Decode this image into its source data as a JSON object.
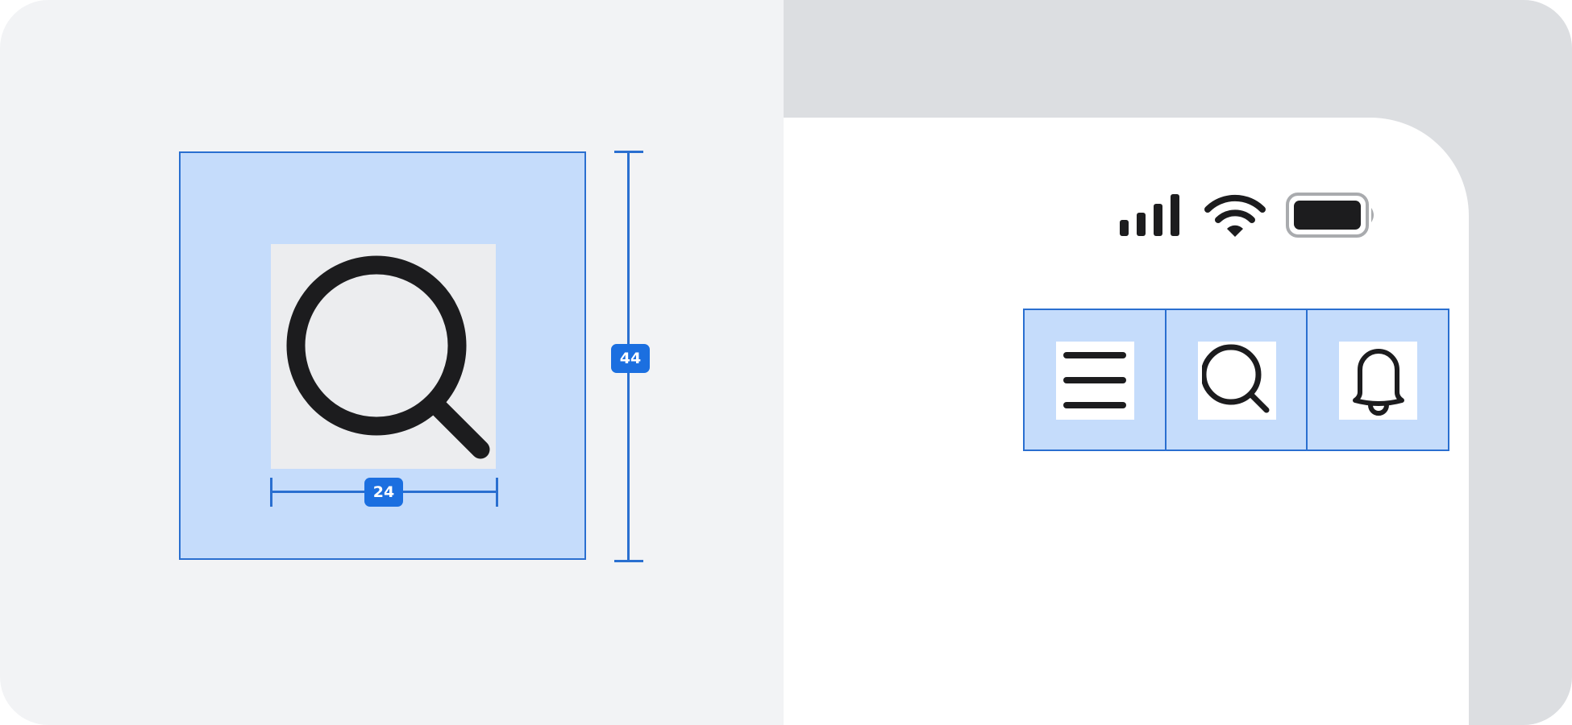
{
  "colors": {
    "accent": "#2a6fd0",
    "badge": "#1b6fe0",
    "target_fill": "#c5dcfb",
    "icon_fill": "#ecedef",
    "ink": "#1c1c1e",
    "left_bg": "#f2f3f5",
    "right_bg": "#dcdee1"
  },
  "measurements": {
    "height_label": "44",
    "width_label": "24"
  },
  "illustration": {
    "icon": "magnifying-glass-icon"
  },
  "status_bar": {
    "icons": [
      "cellular-signal-icon",
      "wifi-icon",
      "battery-icon"
    ]
  },
  "tab_bar": {
    "items": [
      {
        "icon": "menu-icon"
      },
      {
        "icon": "search-icon"
      },
      {
        "icon": "bell-icon"
      }
    ]
  }
}
